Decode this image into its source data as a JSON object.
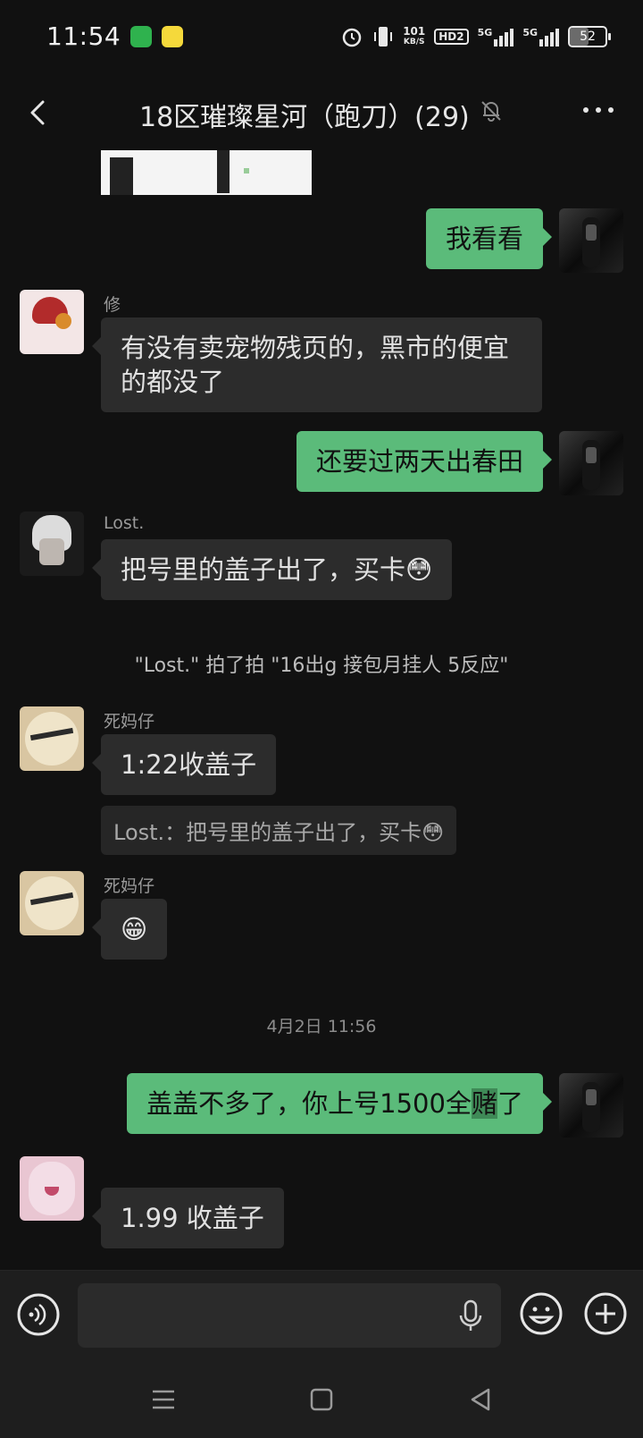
{
  "status_bar": {
    "time": "11:54",
    "net_speed_value": "101",
    "net_speed_unit": "KB/S",
    "hd_label": "HD2",
    "signal1_label": "5G",
    "signal2_label": "5G",
    "battery": "52",
    "battery_level_percent": 52
  },
  "header": {
    "title": "18区璀璨星河（跑刀）(29)",
    "back_icon": "back-chevron-icon",
    "mute_icon": "bell-muted-icon",
    "more_icon": "more-dots-icon"
  },
  "messages": [
    {
      "id": "m1",
      "sender": "",
      "text": "我看看"
    },
    {
      "id": "m2",
      "sender": "修",
      "text": "有没有卖宠物残页的，黑市的便宜的都没了"
    },
    {
      "id": "m3",
      "sender": "",
      "text": "还要过两天出春田"
    },
    {
      "id": "m4",
      "sender": "Lost.",
      "text": "把号里的盖子出了，买卡😳"
    },
    {
      "id": "m5",
      "sender": "死妈仔",
      "text": "1:22收盖子"
    },
    {
      "id": "m6",
      "sender": "死妈仔",
      "text": "😁"
    },
    {
      "id": "m7",
      "sender": "",
      "text_main": "盖盖不多了，你上号1500全",
      "text_highlight": "赌",
      "text_tail": "了"
    },
    {
      "id": "m8",
      "sender": "",
      "text": "1.99 收盖子"
    }
  ],
  "system_pat": "\"Lost.\" 拍了拍 \"16出g 接包月挂人 5反应\"",
  "quote_reply": "Lost.：把号里的盖子出了，买卡😳",
  "time_header": "4月2日 11:56",
  "input_bar": {
    "voice_icon": "voice-mode-icon",
    "mic_icon": "microphone-icon",
    "emoji_icon": "emoji-icon",
    "plus_icon": "plus-icon"
  },
  "nav_bar": {
    "menu_icon": "menu-icon",
    "home_icon": "home-square-icon",
    "back_icon": "back-triangle-icon"
  }
}
